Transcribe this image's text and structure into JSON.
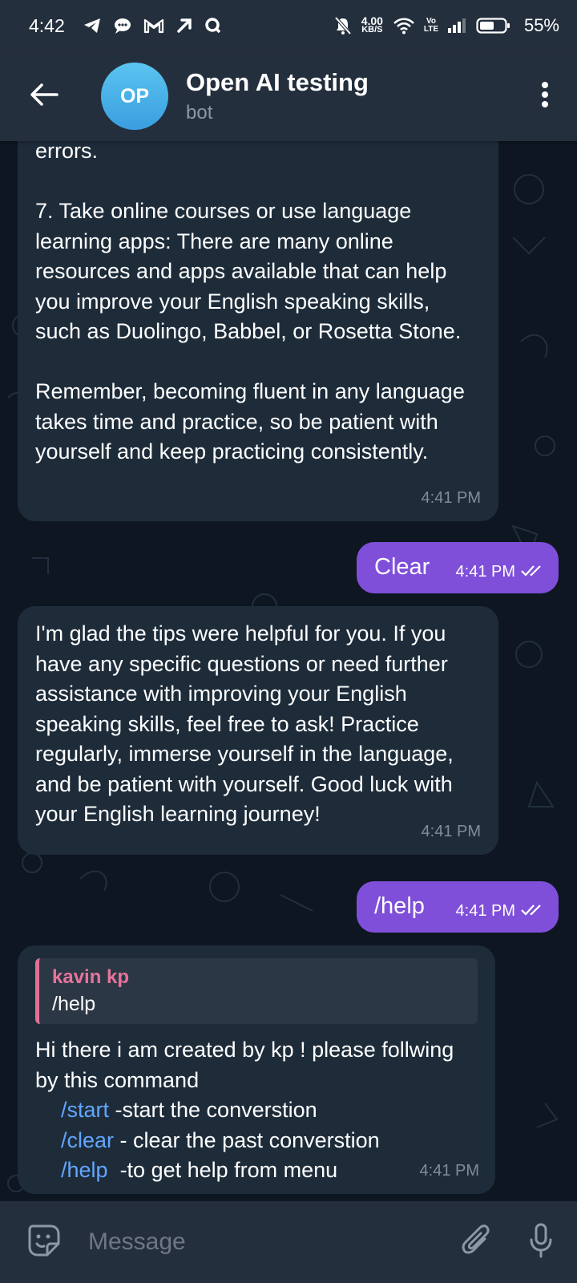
{
  "status_bar": {
    "time": "4:42",
    "net_speed_value": "4.00",
    "net_speed_unit": "KB/S",
    "volte": "Vo LTE",
    "battery": "55%"
  },
  "header": {
    "avatar_initials": "OP",
    "title": "Open AI testing",
    "subtitle": "bot"
  },
  "messages": [
    {
      "direction": "in",
      "text": "errors.\n\n7. Take online courses or use language learning apps: There are many online resources and apps available that can help you improve your English speaking skills, such as Duolingo, Babbel, or Rosetta Stone.\n\nRemember, becoming fluent in any language takes time and practice, so be patient with yourself and keep practicing consistently.",
      "time": "4:41 PM"
    },
    {
      "direction": "out",
      "text": "Clear",
      "time": "4:41 PM"
    },
    {
      "direction": "in",
      "text": "I'm glad the tips were helpful for you. If you have any specific questions or need further assistance with improving your English speaking skills, feel free to ask! Practice regularly, immerse yourself in the language, and be patient with yourself. Good luck with your English learning journey!",
      "time": "4:41 PM"
    },
    {
      "direction": "out",
      "text": "/help",
      "time": "4:41 PM"
    },
    {
      "direction": "in",
      "reply": {
        "name": "kavin kp",
        "text": "/help"
      },
      "intro": "Hi there i am created by kp ! please follwing by this command",
      "commands": [
        {
          "cmd": "/start",
          "desc": " -start the converstion"
        },
        {
          "cmd": "/clear",
          "desc": " - clear the past converstion"
        },
        {
          "cmd": "/help",
          "desc": "  -to get help from menu"
        }
      ],
      "time": "4:41 PM"
    }
  ],
  "input": {
    "placeholder": "Message"
  },
  "colors": {
    "header_bg": "#242f3d",
    "chat_bg": "#0e1621",
    "incoming_bubble": "#1e2c3a",
    "outgoing_bubble": "#7f4fd9",
    "link": "#62a6ff",
    "reply_name": "#e6749b"
  },
  "icons": [
    "back-arrow-icon",
    "more-vertical-icon",
    "sticker-icon",
    "paperclip-icon",
    "microphone-icon",
    "double-check-icon"
  ]
}
